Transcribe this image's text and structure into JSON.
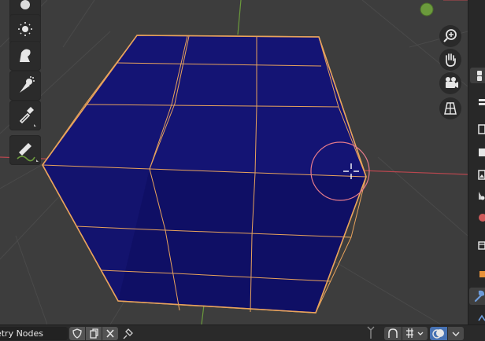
{
  "node_tree": {
    "name": "netry Nodes"
  },
  "colors": {
    "viewport_bg": "#3d3d3d",
    "mesh_face": "#13136e",
    "selection_outline": "#e8a35c",
    "x_axis": "#b8474f",
    "y_axis": "#6b9a3c",
    "brush_circle": "#e47a8b",
    "active_blue": "#4772b3"
  },
  "left_toolbar": {
    "tools": [
      "light-tool-icon",
      "smooth-tool-icon",
      "transform-tool-icon",
      "sample-tool-icon",
      "eyedropper-icon",
      "annotate-icon"
    ]
  },
  "nav_gizmo": {
    "buttons": [
      "zoom-icon",
      "pan-icon",
      "camera-view-icon",
      "grid-view-icon"
    ]
  },
  "properties_tabs": {
    "icons": [
      "tool-tab-icon",
      "render-tab-icon",
      "output-tab-icon",
      "view-layer-tab-icon",
      "scene-tab-icon",
      "world-tab-icon",
      "collection-tab-icon",
      "object-tab-icon",
      "modifier-tab-icon",
      "particles-tab-icon"
    ],
    "active": "modifier-tab-icon"
  }
}
